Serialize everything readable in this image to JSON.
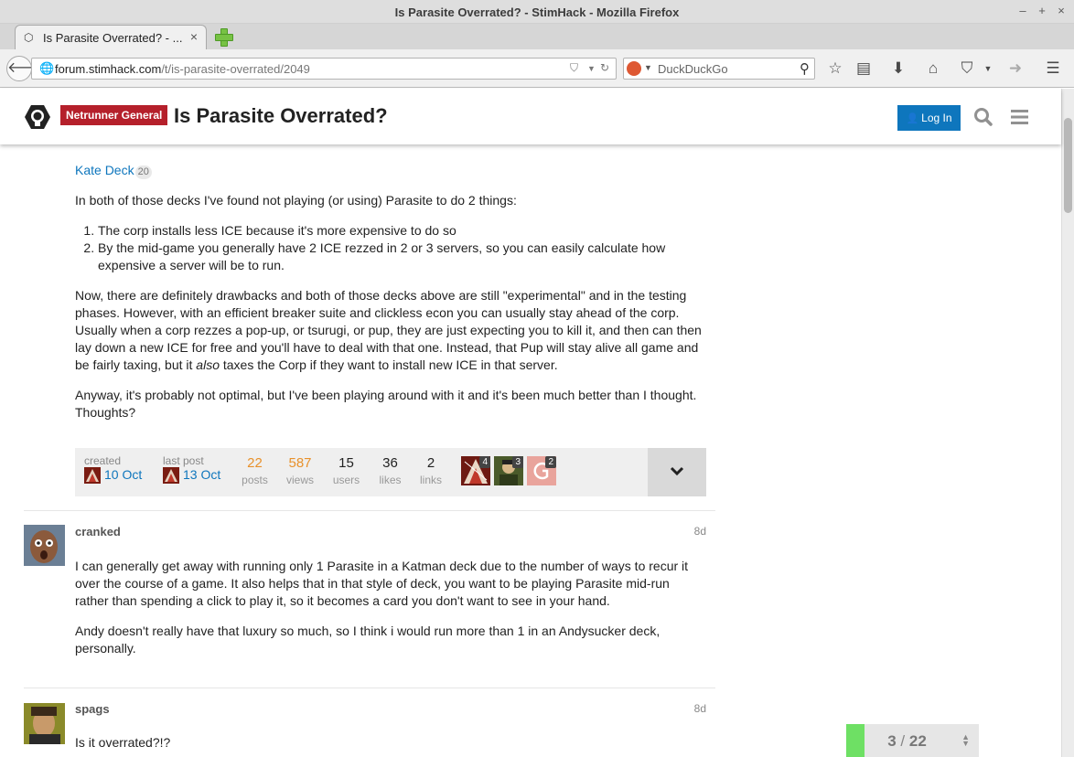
{
  "browser": {
    "window_title": "Is Parasite Overrated? - StimHack - Mozilla Firefox",
    "tab_title": "Is Parasite Overrated? - ...",
    "url_domain": "forum.stimhack.com",
    "url_path": "/t/is-parasite-overrated/2049",
    "search_placeholder": "DuckDuckGo"
  },
  "header": {
    "category": "Netrunner General",
    "category_color": "#b5202b",
    "topic_title": "Is Parasite Overrated?",
    "login_label": "Log In",
    "accent_color": "#0e76bd"
  },
  "post1": {
    "deck_link": "Kate Deck",
    "deck_link_count": "20",
    "para1": "In both of those decks I've found not playing (or using) Parasite to do 2 things:",
    "list": [
      "The corp installs less ICE because it's more expensive to do so",
      "By the mid-game you generally have 2 ICE rezzed in 2 or 3 servers, so you can easily calculate how expensive a server will be to run."
    ],
    "para2_before": "Now, there are definitely drawbacks and both of those decks above are still \"experimental\" and in the testing phases. However, with an efficient breaker suite and clickless econ you can usually stay ahead of the corp. Usually when a corp rezzes a pop-up, or tsurugi, or pup, they are just expecting you to kill it, and then can then lay down a new ICE for free and you'll have to deal with that one. Instead, that Pup will stay alive all game and be fairly taxing, but it ",
    "para2_em": "also",
    "para2_after": " taxes the Corp if they want to install new ICE in that server.",
    "para3": "Anyway, it's probably not optimal, but I've been playing around with it and it's been much better than I thought. Thoughts?"
  },
  "topic_map": {
    "created_label": "created",
    "created_date": "10 Oct",
    "last_post_label": "last post",
    "last_post_date": "13 Oct",
    "posts_num": "22",
    "posts_label": "posts",
    "views_num": "587",
    "views_label": "views",
    "users_num": "15",
    "users_label": "users",
    "likes_num": "36",
    "likes_label": "likes",
    "links_num": "2",
    "links_label": "links",
    "participants": [
      {
        "count": "4"
      },
      {
        "count": "3"
      },
      {
        "count": "2"
      }
    ]
  },
  "post2": {
    "username": "cranked",
    "date": "8d",
    "para1": "I can generally get away with running only 1 Parasite in a Katman deck due to the number of ways to recur it over the course of a game. It also helps that in that style of deck, you want to be playing Parasite mid-run rather than spending a click to play it, so it becomes a card you don't want to see in your hand.",
    "para2": "Andy doesn't really have that luxury so much, so I think i would run more than 1 in an Andysucker deck, personally."
  },
  "post3": {
    "username": "spags",
    "date": "8d",
    "para1": "Is it overrated?!?"
  },
  "progress": {
    "current": "3",
    "total": "22",
    "fill_fraction": 0.136
  }
}
